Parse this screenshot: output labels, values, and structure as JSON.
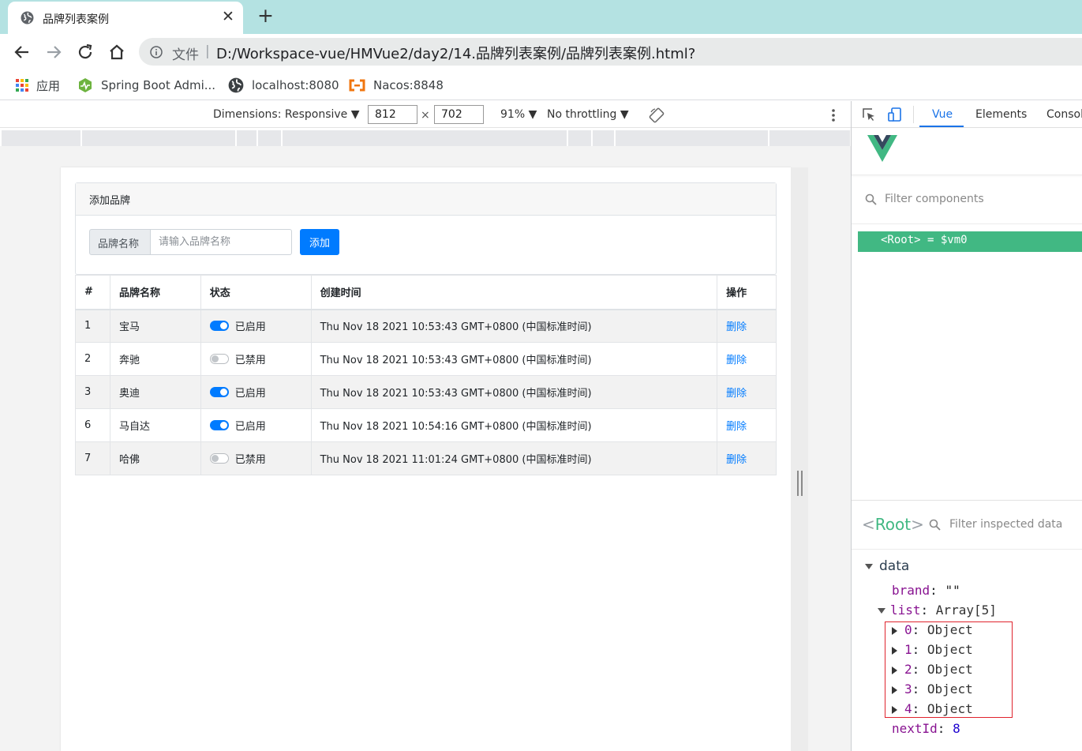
{
  "browser": {
    "tab_title": "品牌列表案例",
    "file_label": "文件",
    "url": "D:/Workspace-vue/HMVue2/day2/14.品牌列表案例/品牌列表案例.html?",
    "bookmarks": [
      {
        "label": "应用",
        "icon": "apps-grid-icon"
      },
      {
        "label": "Spring Boot Admi...",
        "icon": "spring-boot-admin-icon"
      },
      {
        "label": "localhost:8080",
        "icon": "globe-icon"
      },
      {
        "label": "Nacos:8848",
        "icon": "nacos-icon"
      }
    ]
  },
  "device_toolbar": {
    "dimensions_label": "Dimensions: Responsive ▼",
    "width": "812",
    "times": "×",
    "height": "702",
    "zoom": "91% ▼",
    "throttling": "No throttling ▼"
  },
  "app": {
    "card_title": "添加品牌",
    "input_prefix": "品牌名称",
    "input_placeholder": "请输入品牌名称",
    "input_value": "",
    "add_button": "添加",
    "columns": [
      "#",
      "品牌名称",
      "状态",
      "创建时间",
      "操作"
    ],
    "rows": [
      {
        "id": "1",
        "name": "宝马",
        "enabled": true,
        "status": "已启用",
        "time": "Thu Nov 18 2021 10:53:43 GMT+0800 (中国标准时间)",
        "action": "删除"
      },
      {
        "id": "2",
        "name": "奔驰",
        "enabled": false,
        "status": "已禁用",
        "time": "Thu Nov 18 2021 10:53:43 GMT+0800 (中国标准时间)",
        "action": "删除"
      },
      {
        "id": "3",
        "name": "奥迪",
        "enabled": true,
        "status": "已启用",
        "time": "Thu Nov 18 2021 10:53:43 GMT+0800 (中国标准时间)",
        "action": "删除"
      },
      {
        "id": "6",
        "name": "马自达",
        "enabled": true,
        "status": "已启用",
        "time": "Thu Nov 18 2021 10:54:16 GMT+0800 (中国标准时间)",
        "action": "删除"
      },
      {
        "id": "7",
        "name": "哈佛",
        "enabled": false,
        "status": "已禁用",
        "time": "Thu Nov 18 2021 11:01:24 GMT+0800 (中国标准时间)",
        "action": "删除"
      }
    ]
  },
  "devtools": {
    "tabs": [
      "Vue",
      "Elements",
      "Consol"
    ],
    "active_tab": "Vue",
    "filter_components_placeholder": "Filter components",
    "root_row": "<Root> = $vm0",
    "inspect_root": "Root",
    "filter_inspected_placeholder": "Filter inspected data",
    "data_label": "data",
    "brand_key": "brand",
    "brand_value": "\"\"",
    "list_key": "list",
    "list_value": "Array[5]",
    "list_items": [
      {
        "index": "0",
        "value": "Object"
      },
      {
        "index": "1",
        "value": "Object"
      },
      {
        "index": "2",
        "value": "Object"
      },
      {
        "index": "3",
        "value": "Object"
      },
      {
        "index": "4",
        "value": "Object"
      }
    ],
    "nextid_key": "nextId",
    "nextid_value": "8"
  },
  "colors": {
    "accent": "#007bff",
    "vue_green": "#41b883",
    "tabstrip": "#b4e2e2",
    "highlight_border": "#e0242e"
  }
}
